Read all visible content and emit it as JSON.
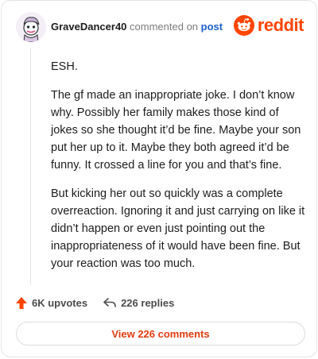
{
  "header": {
    "username": "GraveDancer40",
    "action_text": "commented on",
    "post_link": "post",
    "logo_text": "reddit",
    "logo_icon": "reddit-snoo-icon",
    "avatar_icon": "user-avatar"
  },
  "comment": {
    "paragraphs": [
      "ESH.",
      "The gf made an inappropriate joke. I don’t know why. Possibly her family makes those kind of jokes so she thought it’d be fine. Maybe your son put her up to it. Maybe they both agreed it’d be funny. It crossed a line for you and that’s fine.",
      "But kicking her out so quickly was a complete overreaction. Ignoring it and just carrying on like it didn’t happen or even just pointing out the inappropriateness of it would have been fine. But your reaction was too much."
    ]
  },
  "actions": {
    "upvotes": "6K upvotes",
    "replies": "226 replies",
    "view_comments": "View 226 comments"
  },
  "colors": {
    "brand": "#ff4500",
    "link": "#1b5fcc",
    "view_button_text": "#e23c10"
  }
}
